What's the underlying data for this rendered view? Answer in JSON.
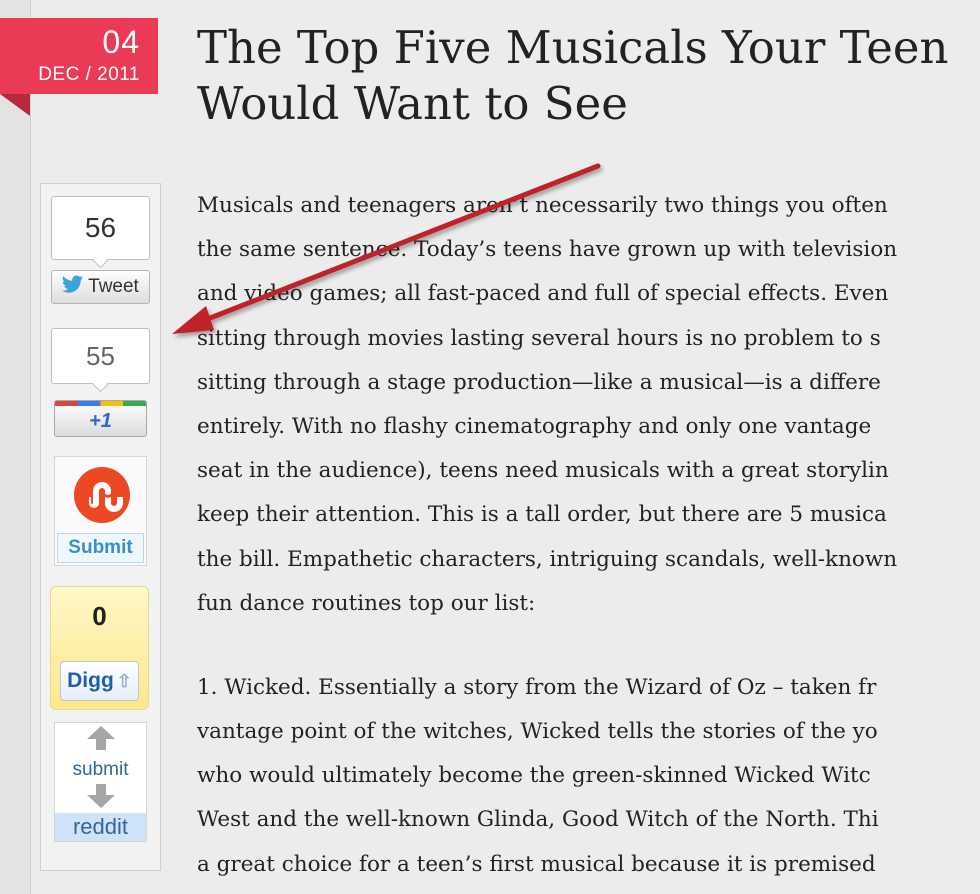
{
  "date": {
    "day": "04",
    "month_year": "DEC / 2011"
  },
  "title": "The Top Five Musicals Your Teen Would Want to See",
  "share": {
    "tweet_count": "56",
    "tweet_label": "Tweet",
    "gplus_count": "55",
    "gplus_label": "+1",
    "stumbleupon_label": "Submit",
    "digg_count": "0",
    "digg_label": "Digg",
    "reddit_submit": "submit",
    "reddit_label": "reddit"
  },
  "icons": {
    "twitter": "twitter-bird-icon",
    "stumbleupon": "stumbleupon-icon",
    "digg_arrow": "up-arrow-icon",
    "reddit_up": "upvote-arrow-icon",
    "reddit_down": "downvote-arrow-icon",
    "annotation": "red-arrow-icon"
  },
  "colors": {
    "date_badge": "#ea3a55",
    "annotation_arrow": "#c0202b"
  },
  "article": {
    "paragraph1": [
      "Musicals and teenagers aren’t necessarily two things you often",
      "the same sentence. Today’s teens have grown up with television",
      "and video games; all fast-paced and full of special effects. Even",
      "sitting through movies lasting several hours is no problem to s",
      "sitting through a stage production—like a musical—is a differe",
      "entirely. With no flashy cinematography and only one vantage",
      "seat in the audience), teens need musicals with a great storylin",
      "keep their attention. This is a tall order, but there are 5 musica",
      "the bill. Empathetic characters, intriguing scandals, well-known",
      "fun dance routines top our list:"
    ],
    "paragraph2": [
      "1. Wicked. Essentially a story from the Wizard of Oz – taken fr",
      "vantage point of the witches, Wicked tells the stories of the yo",
      "who would ultimately become the green-skinned Wicked Witc",
      "West and the well-known Glinda, Good Witch of the North. Thi",
      "a great choice for a teen’s first musical because it is premised"
    ]
  }
}
